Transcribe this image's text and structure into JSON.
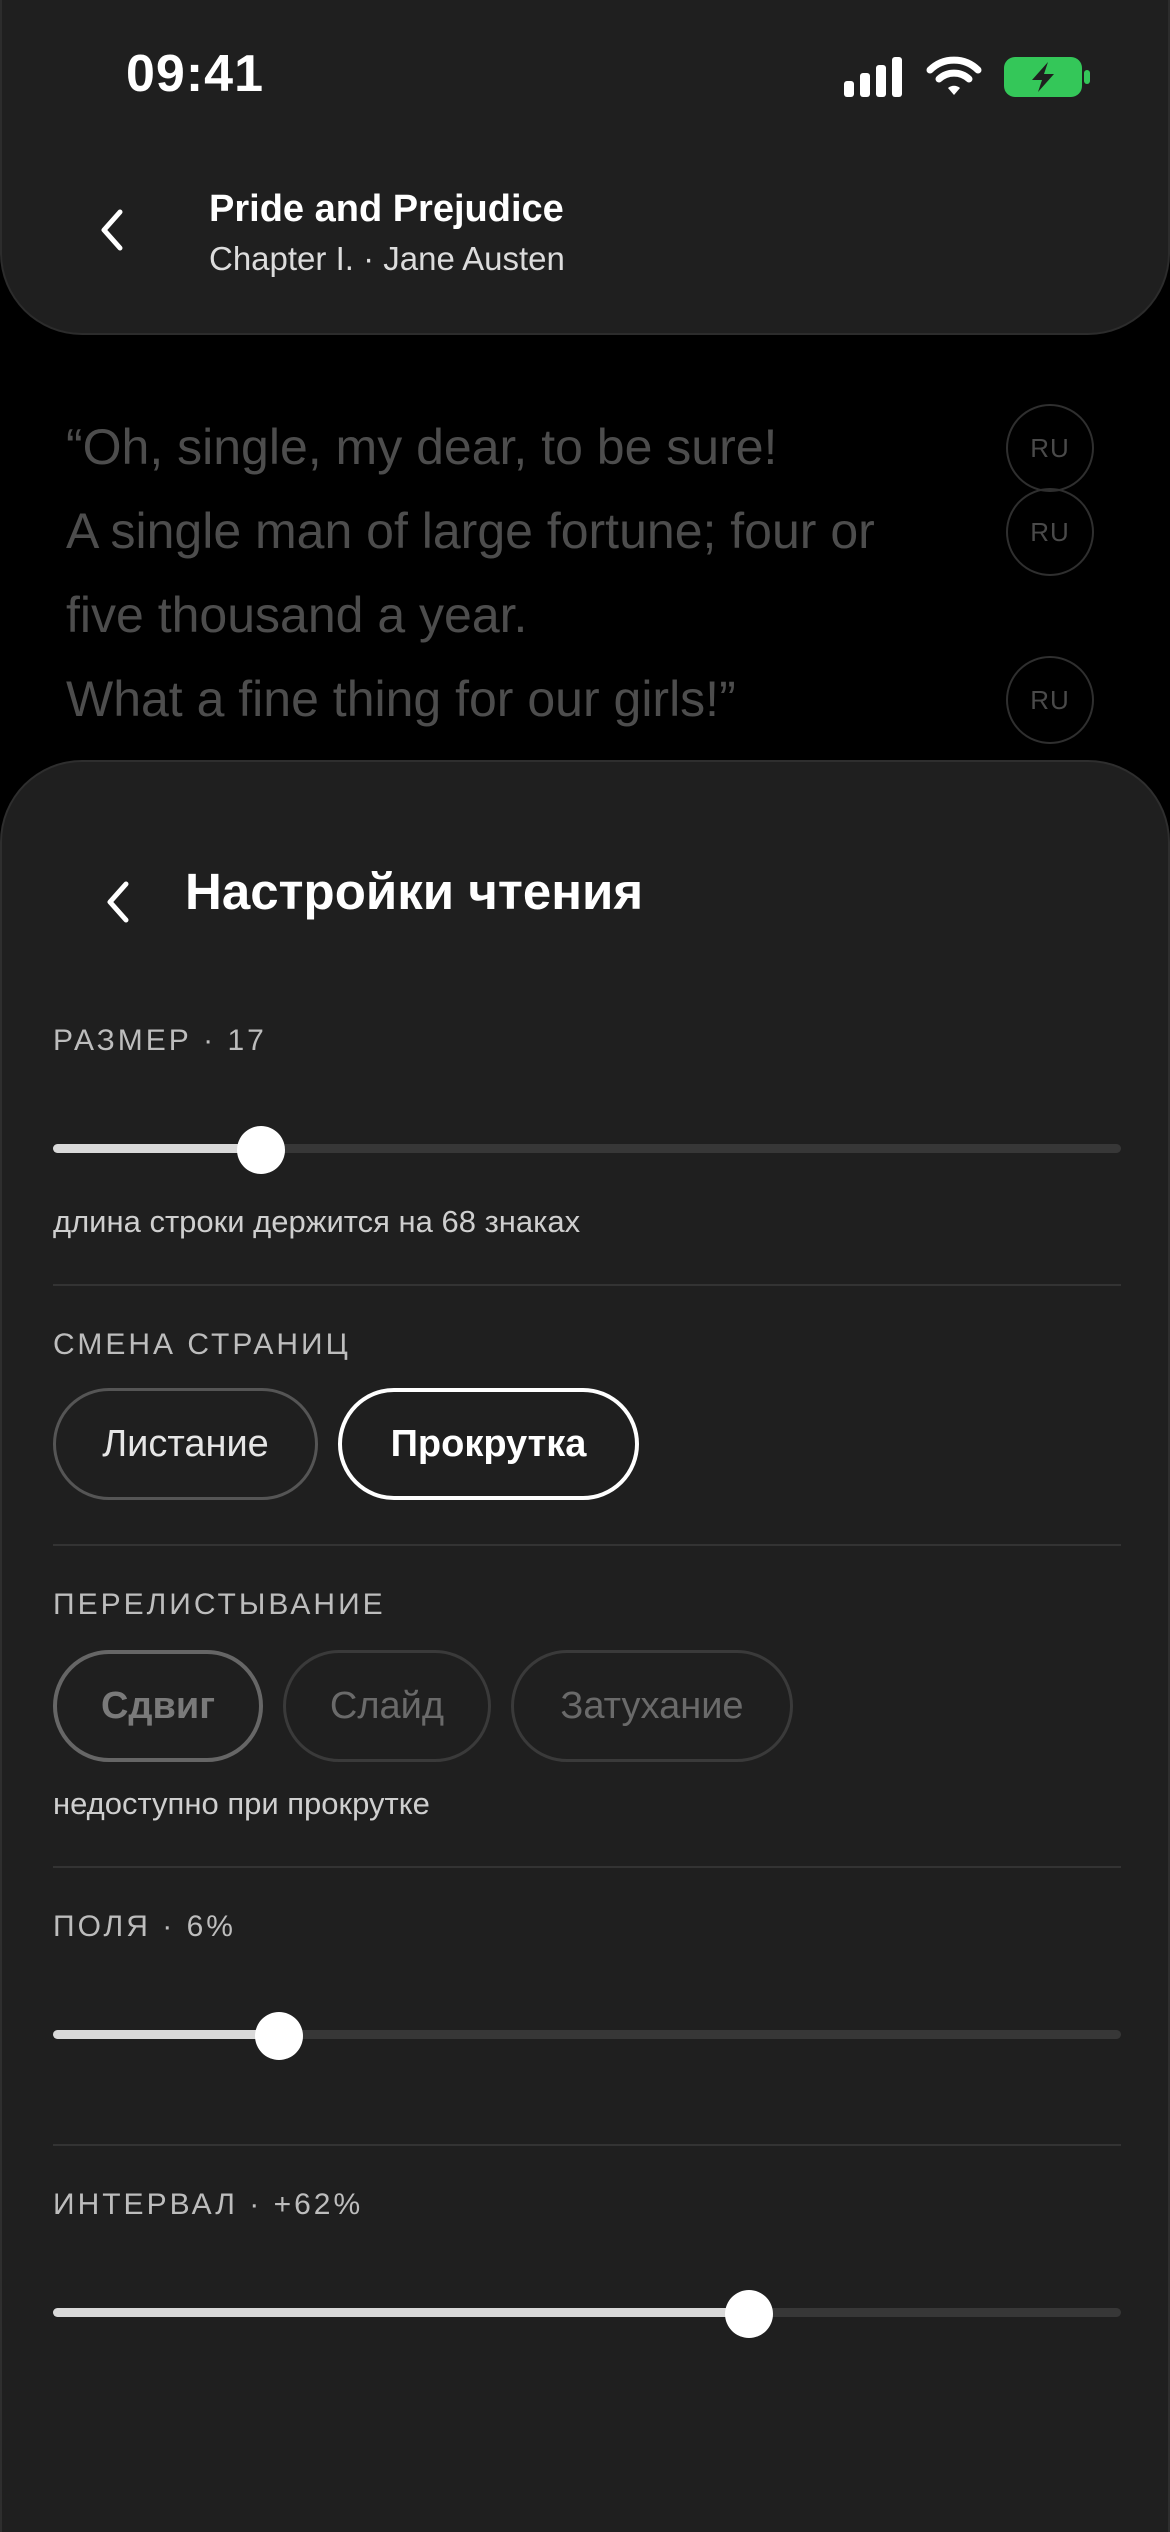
{
  "status_bar": {
    "time": "09:41"
  },
  "header": {
    "title": "Pride and Prejudice",
    "subtitle": "Chapter I. · Jane Austen"
  },
  "reader": {
    "lines": [
      "“Oh, single, my dear, to be sure!",
      "A single man of large fortune; four or",
      "five thousand a year.",
      "What a fine thing for our girls!”"
    ],
    "translate_label": "RU"
  },
  "settings": {
    "title": "Настройки чтения",
    "size": {
      "label": "РАЗМЕР · 17",
      "value": 17,
      "slider_fraction": 0.195,
      "note": "длина строки держится на 68 знаках"
    },
    "page_mode": {
      "label": "СМЕНА СТРАНИЦ",
      "options": [
        "Листание",
        "Прокрутка"
      ],
      "selected": "Прокрутка"
    },
    "page_turn": {
      "label": "ПЕРЕЛИСТЫВАНИЕ",
      "options": [
        "Сдвиг",
        "Слайд",
        "Затухание"
      ],
      "selected": "Сдвиг",
      "note": "недоступно при прокрутке"
    },
    "margins": {
      "label": "ПОЛЯ · 6%",
      "slider_fraction": 0.212
    },
    "spacing": {
      "label": "ИНТЕРВАЛ · +62%",
      "slider_fraction": 0.652
    }
  },
  "colors": {
    "background": "#000000",
    "sheet": "#1f1f1f",
    "battery": "#34c759"
  }
}
